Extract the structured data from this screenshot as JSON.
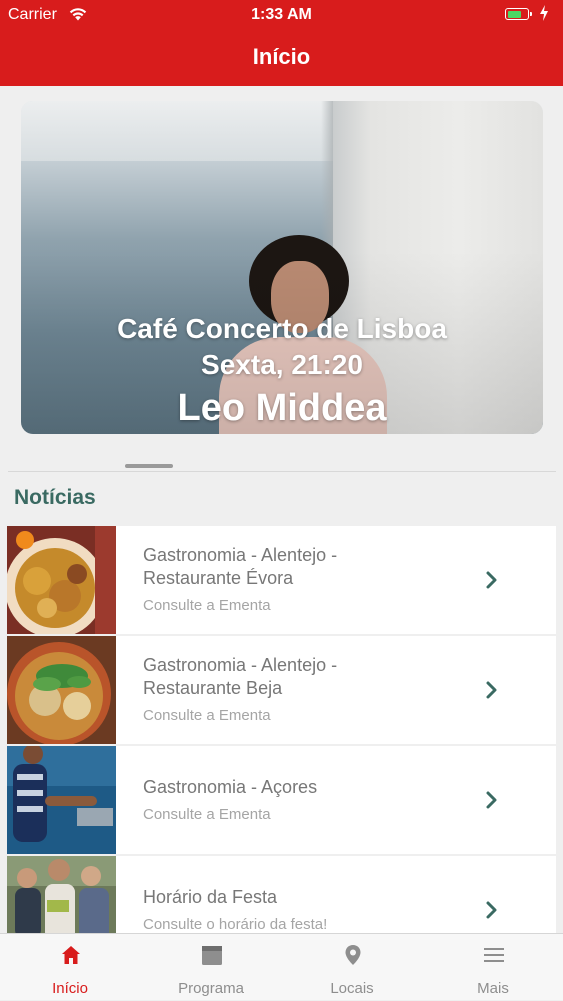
{
  "status_bar": {
    "carrier": "Carrier",
    "time": "1:33 AM",
    "battery_level": 0.75
  },
  "nav": {
    "title": "Início"
  },
  "featured": {
    "venue": "Café Concerto de Lisboa",
    "when": "Sexta, 21:20",
    "artist": "Leo Middea"
  },
  "news": {
    "section_title": "Notícias",
    "items": [
      {
        "title_line1": "Gastronomia - Alentejo -",
        "title_line2": "Restaurante Évora",
        "subtitle": "Consulte a Ementa"
      },
      {
        "title_line1": "Gastronomia - Alentejo -",
        "title_line2": "Restaurante Beja",
        "subtitle": "Consulte a Ementa"
      },
      {
        "title_line1": "Gastronomia - Açores",
        "title_line2": "",
        "subtitle": "Consulte a Ementa"
      },
      {
        "title_line1": "Horário da Festa",
        "title_line2": "",
        "subtitle": "Consulte o horário da festa!"
      }
    ]
  },
  "tabbar": {
    "tabs": [
      {
        "label": "Início",
        "icon": "home-icon",
        "active": true
      },
      {
        "label": "Programa",
        "icon": "calendar-icon",
        "active": false
      },
      {
        "label": "Locais",
        "icon": "location-pin-icon",
        "active": false
      },
      {
        "label": "Mais",
        "icon": "menu-icon",
        "active": false
      }
    ]
  },
  "colors": {
    "brand_red": "#d81c1c",
    "section_green": "#3a6a62",
    "chevron": "#3a6a62",
    "battery_green": "#4cd964"
  }
}
